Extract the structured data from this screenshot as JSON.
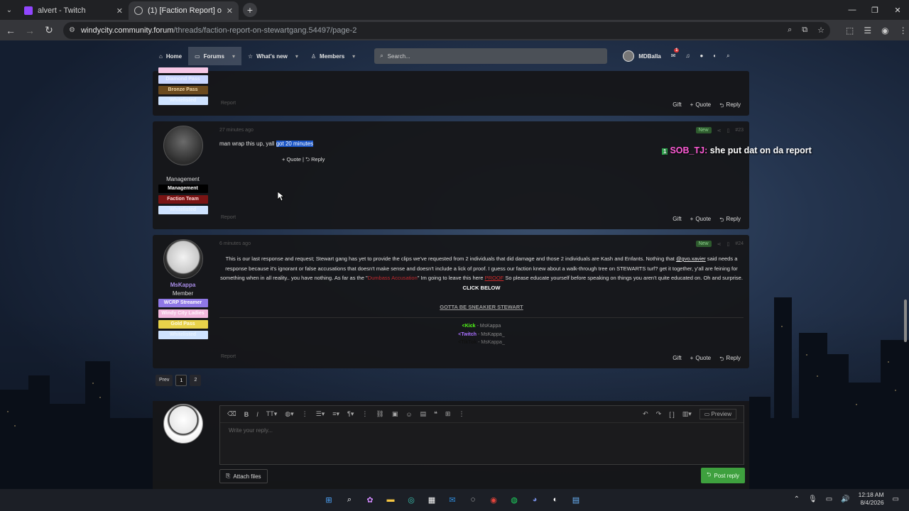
{
  "browser": {
    "tabs": [
      {
        "title": "alvert - Twitch",
        "close": "✕",
        "active": false
      },
      {
        "title": "(1) [Faction Report] on Stewart",
        "close": "✕",
        "active": true
      }
    ],
    "new_tab": "+",
    "window_controls": {
      "minimize": "—",
      "maximize": "❐",
      "close": "✕"
    },
    "url_host": "windycity.community.forum",
    "url_path": "/threads/faction-report-on-stewartgang.54497/page-2"
  },
  "nav": {
    "home": "Home",
    "forums": "Forums",
    "whats_new": "What's new",
    "members": "Members",
    "search_placeholder": "Search...",
    "username": "MDBalla",
    "inbox_badge": "1"
  },
  "posts": [
    {
      "badges": [
        "Diamond Pass",
        "Bronze Pass",
        "Whitelisted"
      ],
      "report": "Report",
      "actions": {
        "gift": "Gift",
        "quote": "Quote",
        "reply": "Reply"
      }
    },
    {
      "time": "27 minutes ago",
      "tag": "New",
      "number": "#23",
      "role": "Management",
      "badges": [
        "Management",
        "Faction Team",
        "Whitelisted"
      ],
      "text_plain": "man wrap this up, yall ",
      "text_highlight": "got 20 minutes",
      "inline_quote": "Quote",
      "inline_reply": "Reply",
      "report": "Report",
      "actions": {
        "gift": "Gift",
        "quote": "Quote",
        "reply": "Reply"
      }
    },
    {
      "time": "6 minutes ago",
      "tag": "New",
      "number": "#24",
      "username": "MsKappa",
      "role": "Member",
      "badges": [
        "WCRP Streamer",
        "Windy City Ladies",
        "Gold Pass",
        "Whitelisted"
      ],
      "text_a": "This is our last response and request; Stewart gang has yet to provide the clips we've requested from 2 individuals that did damage and those 2 individuals are Kash and Enfants. Nothing that",
      "mention": "@gvo.xavier",
      "text_b": "said needs a response because it's ignorant or false accusations that doesn't make sense and doesn't include a lick of proof. I guess our faction knew about a walk-through tree on STEWARTS turf? get it together, y'all are feining for something when in all reality.. you have nothing. As far as the \"",
      "red_text": "Dumbass Accusation",
      "text_c": "\" Im going to leave this here",
      "proof": "PROOF",
      "text_d": "So please educate yourself before speaking on things you aren't quite educated on. Oh and surprise.",
      "click_below": "CLICK BELOW",
      "sneakier": "GOTTA BE SNEAKIER STEWART",
      "sig_kick": "<Kick",
      "sig_kick_name": " - MsKappa",
      "sig_twitch": "<Twitch",
      "sig_twitch_name": " - MsKappa_",
      "sig_tiktok": "<TikTok",
      "sig_tiktok_name": " - MsKappa_",
      "report": "Report",
      "actions": {
        "gift": "Gift",
        "quote": "Quote",
        "reply": "Reply"
      }
    }
  ],
  "pager": {
    "prev": "Prev",
    "page1": "1",
    "page2": "2"
  },
  "reply": {
    "placeholder": "Write your reply...",
    "preview": "Preview",
    "attach": "Attach files",
    "post": "Post reply"
  },
  "chat_overlay": {
    "badge": "1",
    "name": "SOB_TJ:",
    "message": "she put dat on da report"
  },
  "taskbar": {
    "time": "12:18 AM",
    "date": "8/4/2026",
    "discord_badge": "99+"
  },
  "colors": {
    "accent": "#1a55c6",
    "post_reply_green": "#3ea03e",
    "username_purple": "#a98de8",
    "mention_red": "#c0282d"
  }
}
